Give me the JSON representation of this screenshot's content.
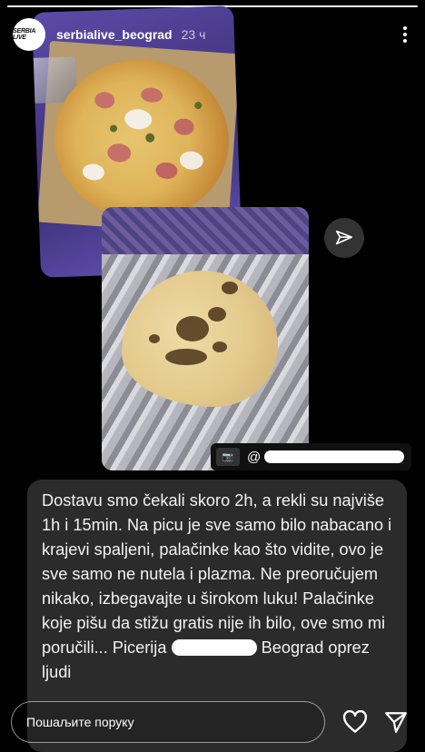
{
  "story": {
    "progress": 1.0
  },
  "header": {
    "avatar_text": "SERBIA LIVE",
    "username": "serbialive_beograd",
    "time": "23 ч"
  },
  "mention": {
    "at": "@"
  },
  "caption": {
    "part1": "Dostavu smo čekali skoro 2h, a rekli su najviše 1h i 15min. Na picu je sve samo bilo nabacano i krajevi spaljeni, palačinke kao što vidite, ovo je sve samo ne nutela i plazma. Ne preoručujem nikako, izbegavajte u širokom luku! Palačinke koje pišu da stižu gratis nije ih bilo, ove smo mi poručili... Picerija ",
    "part2": " Beograd oprez ljudi"
  },
  "reply": {
    "placeholder": "Пошаљите поруку"
  },
  "icons": {
    "more": "more-vertical-icon",
    "share": "send-icon",
    "like": "heart-icon",
    "send": "send-icon"
  },
  "colors": {
    "background": "#000000",
    "card": "#2b2b2b"
  }
}
